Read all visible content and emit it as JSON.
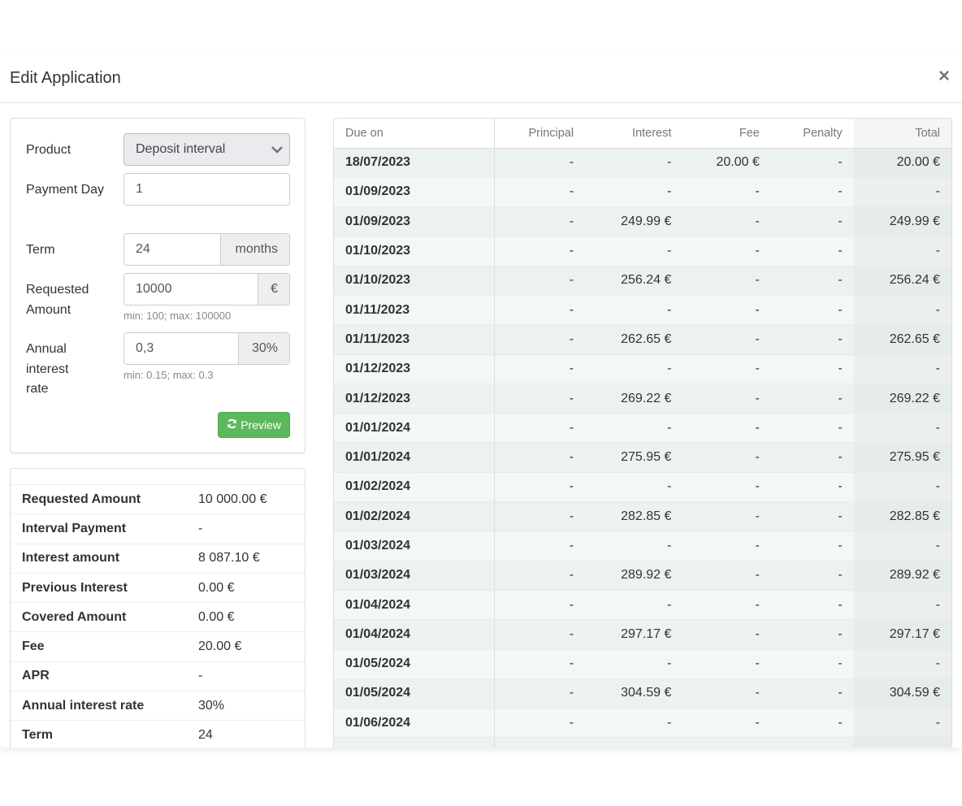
{
  "modal": {
    "title": "Edit Application",
    "close_icon": "close-icon"
  },
  "form": {
    "product": {
      "label": "Product",
      "value": "Deposit interval"
    },
    "payment_day": {
      "label": "Payment Day",
      "value": "1"
    },
    "term": {
      "label": "Term",
      "value": "24",
      "addon": "months"
    },
    "requested_amount": {
      "label": "Requested Amount",
      "value": "10000",
      "addon": "€",
      "help": "min: 100; max: 100000"
    },
    "annual_interest_rate": {
      "label": "Annual interest rate",
      "value": "0,3",
      "addon": "30%",
      "help": "min: 0.15; max: 0.3"
    },
    "preview_button": {
      "label": "Preview",
      "icon": "refresh-icon",
      "color": "#5cb85c"
    }
  },
  "summary": [
    {
      "label": "Requested Amount",
      "value": "10 000.00 €"
    },
    {
      "label": "Interval Payment",
      "value": "-"
    },
    {
      "label": "Interest amount",
      "value": "8 087.10 €"
    },
    {
      "label": "Previous Interest",
      "value": "0.00 €"
    },
    {
      "label": "Covered Amount",
      "value": "0.00 €"
    },
    {
      "label": "Fee",
      "value": "20.00 €"
    },
    {
      "label": "APR",
      "value": "-"
    },
    {
      "label": "Annual interest rate",
      "value": "30%"
    },
    {
      "label": "Term",
      "value": "24"
    }
  ],
  "schedule": {
    "columns": [
      "Due on",
      "Principal",
      "Interest",
      "Fee",
      "Penalty",
      "Total"
    ],
    "rows": [
      [
        "18/07/2023",
        "-",
        "-",
        "20.00 €",
        "-",
        "20.00 €"
      ],
      [
        "01/09/2023",
        "-",
        "-",
        "-",
        "-",
        "-"
      ],
      [
        "01/09/2023",
        "-",
        "249.99 €",
        "-",
        "-",
        "249.99 €"
      ],
      [
        "01/10/2023",
        "-",
        "-",
        "-",
        "-",
        "-"
      ],
      [
        "01/10/2023",
        "-",
        "256.24 €",
        "-",
        "-",
        "256.24 €"
      ],
      [
        "01/11/2023",
        "-",
        "-",
        "-",
        "-",
        "-"
      ],
      [
        "01/11/2023",
        "-",
        "262.65 €",
        "-",
        "-",
        "262.65 €"
      ],
      [
        "01/12/2023",
        "-",
        "-",
        "-",
        "-",
        "-"
      ],
      [
        "01/12/2023",
        "-",
        "269.22 €",
        "-",
        "-",
        "269.22 €"
      ],
      [
        "01/01/2024",
        "-",
        "-",
        "-",
        "-",
        "-"
      ],
      [
        "01/01/2024",
        "-",
        "275.95 €",
        "-",
        "-",
        "275.95 €"
      ],
      [
        "01/02/2024",
        "-",
        "-",
        "-",
        "-",
        "-"
      ],
      [
        "01/02/2024",
        "-",
        "282.85 €",
        "-",
        "-",
        "282.85 €"
      ],
      [
        "01/03/2024",
        "-",
        "-",
        "-",
        "-",
        "-"
      ],
      [
        "01/03/2024",
        "-",
        "289.92 €",
        "-",
        "-",
        "289.92 €"
      ],
      [
        "01/04/2024",
        "-",
        "-",
        "-",
        "-",
        "-"
      ],
      [
        "01/04/2024",
        "-",
        "297.17 €",
        "-",
        "-",
        "297.17 €"
      ],
      [
        "01/05/2024",
        "-",
        "-",
        "-",
        "-",
        "-"
      ],
      [
        "01/05/2024",
        "-",
        "304.59 €",
        "-",
        "-",
        "304.59 €"
      ],
      [
        "01/06/2024",
        "-",
        "-",
        "-",
        "-",
        "-"
      ],
      [
        "",
        "",
        "",
        "",
        "",
        ""
      ]
    ]
  }
}
